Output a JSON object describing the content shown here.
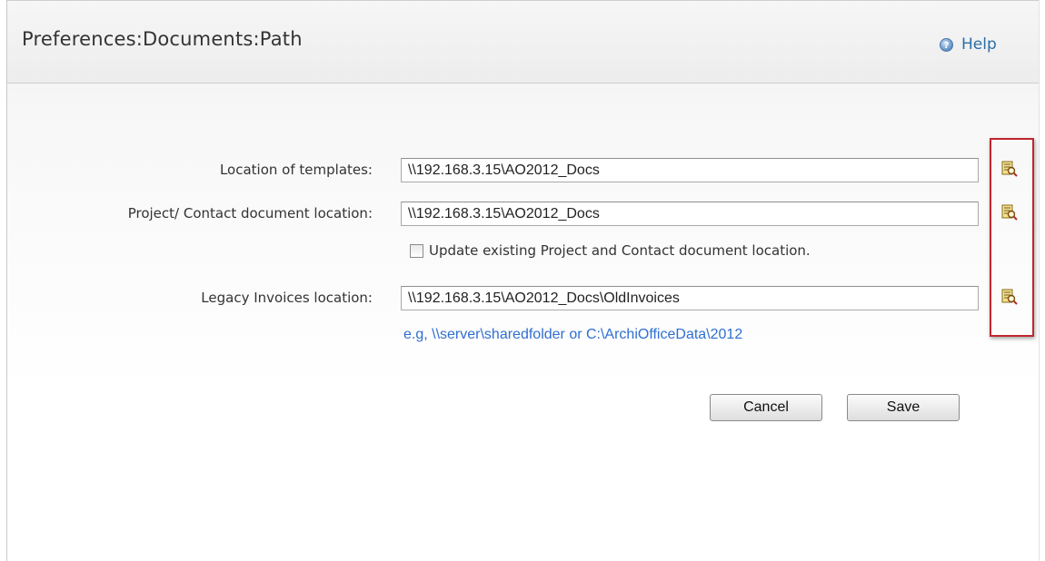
{
  "header": {
    "title": "Preferences:Documents:Path",
    "help_label": "Help",
    "help_icon": "help-icon"
  },
  "form": {
    "templates": {
      "label": "Location of templates:",
      "value": "\\\\192.168.3.15\\AO2012_Docs"
    },
    "project_contact": {
      "label": "Project/ Contact document location:",
      "value": "\\\\192.168.3.15\\AO2012_Docs"
    },
    "update_checkbox": {
      "label": "Update existing Project and Contact document location.",
      "checked": false
    },
    "legacy_invoices": {
      "label": "Legacy Invoices location:",
      "value": "\\\\192.168.3.15\\AO2012_Docs\\OldInvoices"
    },
    "hint": "e.g, \\\\server\\sharedfolder or C:\\ArchiOfficeData\\2012",
    "browse_icon": "browse-folder-icon"
  },
  "actions": {
    "cancel_label": "Cancel",
    "save_label": "Save"
  },
  "colors": {
    "link": "#2a6ea8",
    "hint": "#2f6fd1",
    "highlight": "#c0272d"
  }
}
